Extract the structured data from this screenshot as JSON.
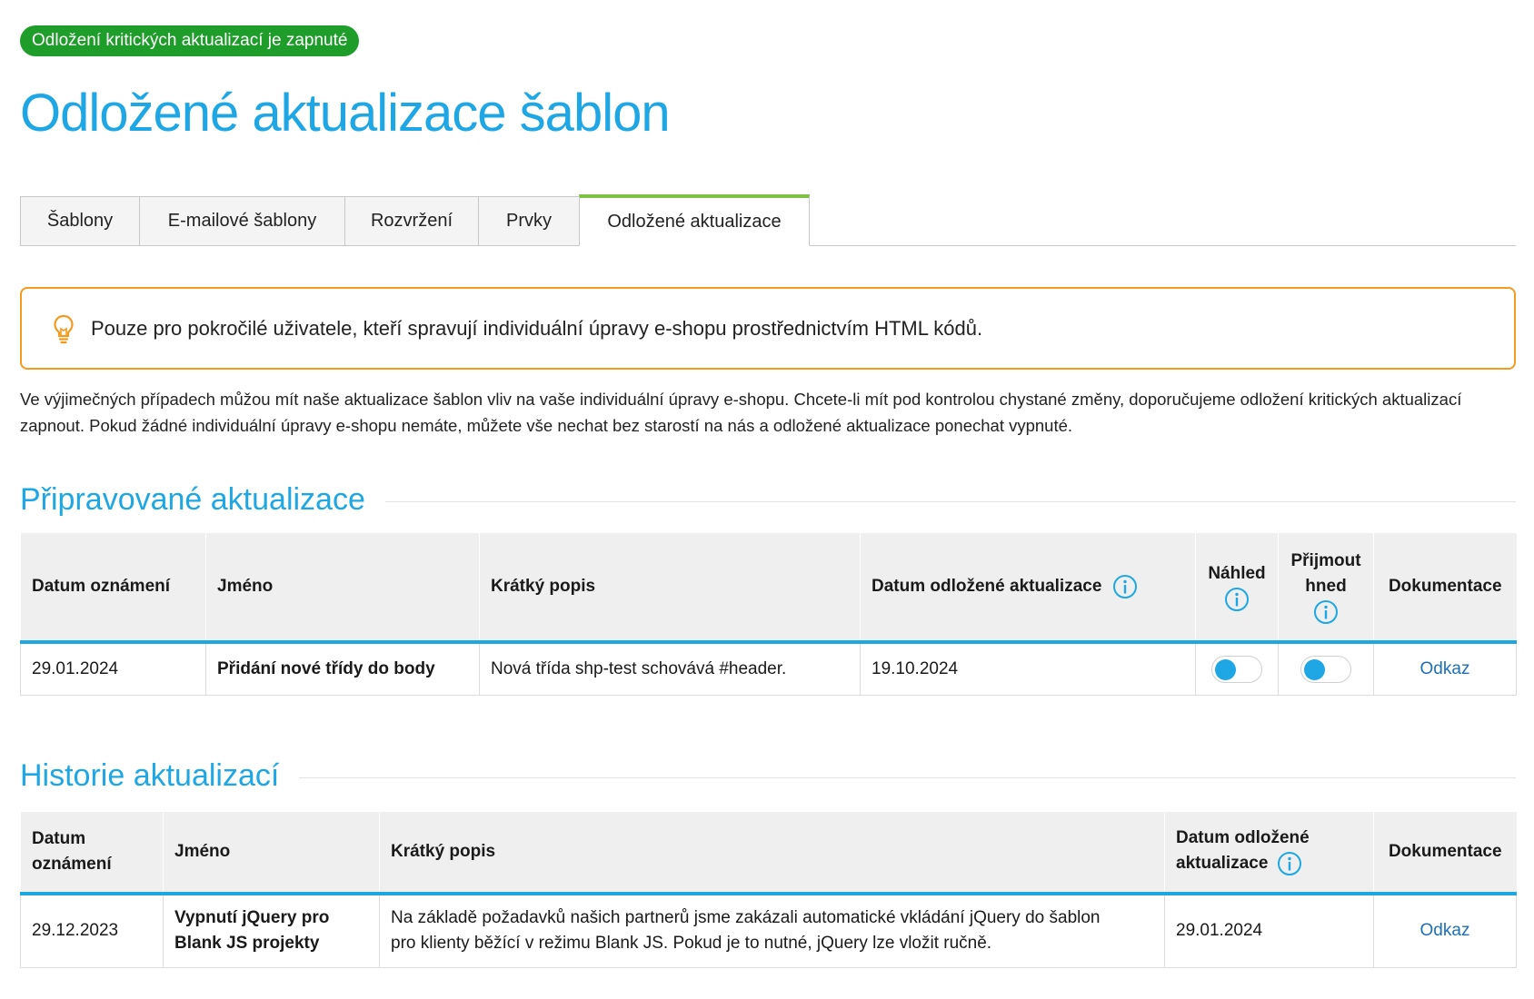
{
  "status_badge": "Odložení kritických aktualizací je zapnuté",
  "page_title": "Odložené aktualizace šablon",
  "tabs": [
    {
      "label": "Šablony"
    },
    {
      "label": "E-mailové šablony"
    },
    {
      "label": "Rozvržení"
    },
    {
      "label": "Prvky"
    },
    {
      "label": "Odložené aktualizace",
      "active": true
    }
  ],
  "tip": {
    "icon": "lightbulb-icon",
    "text": "Pouze pro pokročilé uživatele, kteří spravují individuální úpravy e-shopu prostřednictvím HTML kódů."
  },
  "intro_text": "Ve výjimečných případech můžou mít naše aktualizace šablon vliv na vaše individuální úpravy e-shopu. Chcete-li mít pod kontrolou chystané změny, doporučujeme odložení kritických aktualizací zapnout. Pokud žádné individuální úpravy e-shopu nemáte, můžete vše nechat bez starostí na nás a odložené aktualizace ponechat vypnuté.",
  "upcoming": {
    "title": "Připravované aktualizace",
    "headers": {
      "date": "Datum oznámení",
      "name": "Jméno",
      "desc": "Krátký popis",
      "deferred": "Datum odložené aktualizace",
      "preview": "Náhled",
      "accept_l1": "Přijmout",
      "accept_l2": "hned",
      "docs": "Dokumentace"
    },
    "rows": [
      {
        "date": "29.01.2024",
        "name": "Přidání nové třídy do body",
        "desc": "Nová třída shp-test schovává #header.",
        "deferred": "19.10.2024",
        "preview_on": false,
        "accept_on": false,
        "docs": "Odkaz"
      }
    ]
  },
  "history": {
    "title": "Historie aktualizací",
    "headers": {
      "date_l1": "Datum",
      "date_l2": "oznámení",
      "name": "Jméno",
      "desc": "Krátký popis",
      "deferred_l1": "Datum odložené",
      "deferred_l2": "aktualizace",
      "docs": "Dokumentace"
    },
    "rows": [
      {
        "date": "29.12.2023",
        "name_l1": "Vypnutí jQuery pro",
        "name_l2": "Blank JS projekty",
        "desc_l1": "Na základě požadavků našich partnerů jsme zakázali automatické vkládání jQuery do šablon",
        "desc_l2": "pro klienty běžící v režimu Blank JS. Pokud je to nutné, jQuery lze vložit ručně.",
        "deferred": "29.01.2024",
        "docs": "Odkaz"
      }
    ]
  },
  "colors": {
    "accent": "#1ea7e4",
    "badge": "#1f9d2a",
    "tab_active": "#7dc242",
    "tip_border": "#f39a1f",
    "link": "#1d6fb8"
  }
}
